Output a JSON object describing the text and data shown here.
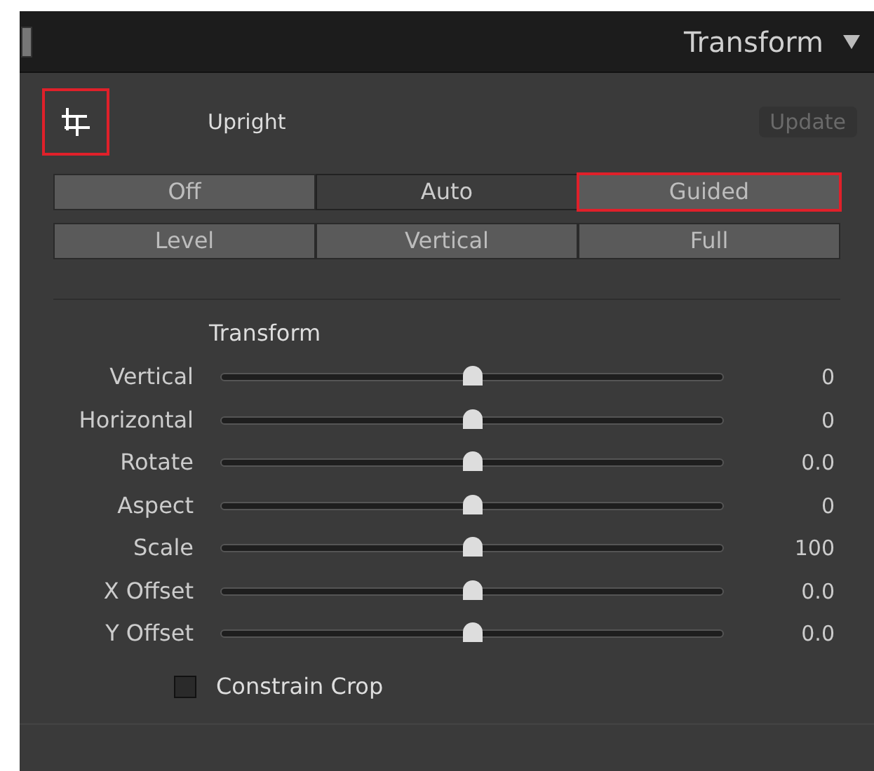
{
  "header": {
    "title": "Transform"
  },
  "upright": {
    "tool_highlighted": true,
    "label": "Upright",
    "update": {
      "label": "Update",
      "disabled": true
    },
    "modes": [
      {
        "label": "Off",
        "selected": false,
        "highlighted": false
      },
      {
        "label": "Auto",
        "selected": true,
        "highlighted": false
      },
      {
        "label": "Guided",
        "selected": false,
        "highlighted": true
      },
      {
        "label": "Level",
        "selected": false,
        "highlighted": false
      },
      {
        "label": "Vertical",
        "selected": false,
        "highlighted": false
      },
      {
        "label": "Full",
        "selected": false,
        "highlighted": false
      }
    ]
  },
  "transform": {
    "title": "Transform",
    "sliders": [
      {
        "name": "Vertical",
        "level": 0.5,
        "reading": "0"
      },
      {
        "name": "Horizontal",
        "level": 0.5,
        "reading": "0"
      },
      {
        "name": "Rotate",
        "level": 0.5,
        "reading": "0.0"
      },
      {
        "name": "Aspect",
        "level": 0.5,
        "reading": "0"
      },
      {
        "name": "Scale",
        "level": 0.5,
        "reading": "100"
      },
      {
        "name": "X Offset",
        "level": 0.5,
        "reading": "0.0"
      },
      {
        "name": "Y Offset",
        "level": 0.5,
        "reading": "0.0"
      }
    ],
    "constrain_crop": {
      "label": "Constrain Crop",
      "checked": false
    }
  }
}
